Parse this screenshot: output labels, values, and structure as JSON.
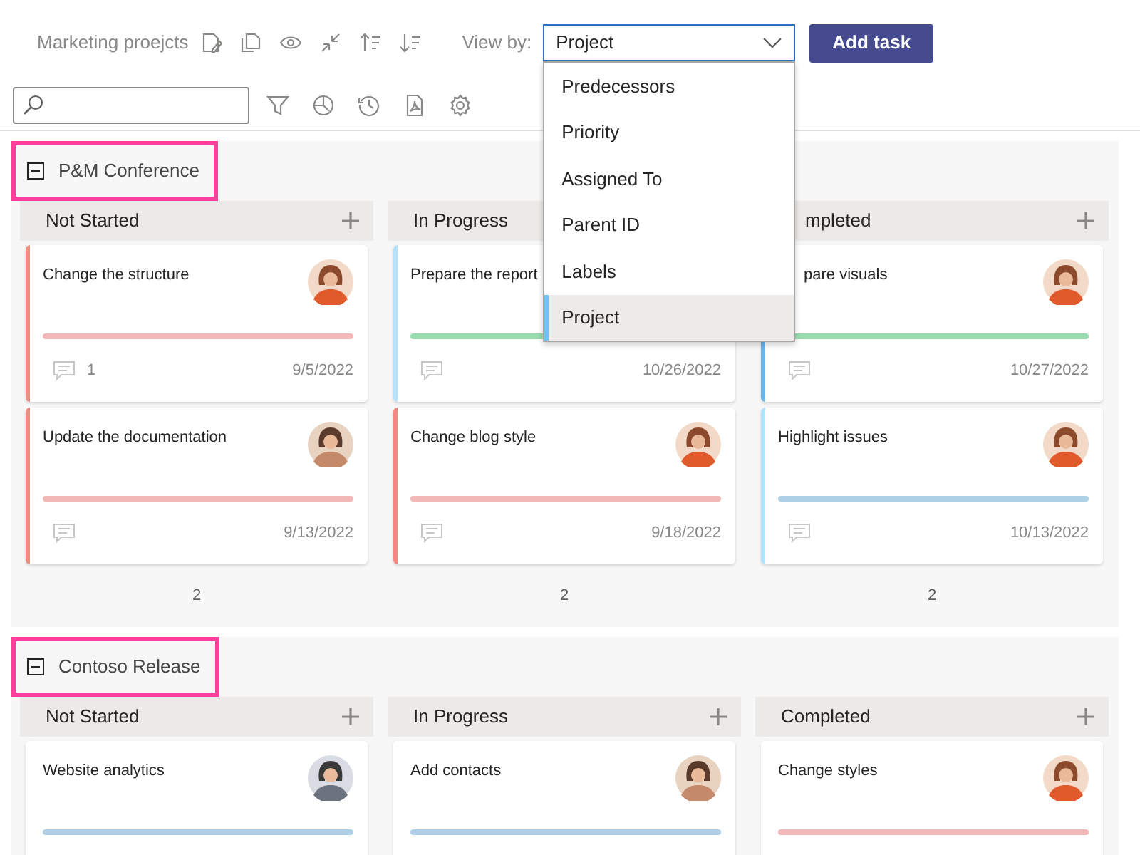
{
  "title": "Marketing proejcts",
  "view_by": {
    "label": "View by:",
    "value": "Project",
    "expanded": true,
    "options": [
      {
        "label": "Predecessors",
        "selected": false
      },
      {
        "label": "Priority",
        "selected": false
      },
      {
        "label": "Assigned To",
        "selected": false
      },
      {
        "label": "Parent ID",
        "selected": false
      },
      {
        "label": "Labels",
        "selected": false
      },
      {
        "label": "Project",
        "selected": true
      }
    ]
  },
  "add_button": "Add task",
  "groups": [
    {
      "name": "P&M Conference",
      "highlighted": true,
      "expanded": true,
      "columns": [
        {
          "label": "Not Started",
          "label_clipped": false,
          "count": "2",
          "cards": [
            {
              "title": "Change the structure",
              "title_clipped": false,
              "avatar": {
                "kind": "woman"
              },
              "color": "#f28b82",
              "bar": {
                "color": "#f2b8b8"
              },
              "comments": "1",
              "date": "9/5/2022"
            },
            {
              "title": "Update the documentation",
              "title_clipped": false,
              "avatar": {
                "kind": "glasses"
              },
              "color": "#f28b82",
              "bar": {
                "color": "#f2b8b8"
              },
              "date": "9/13/2022"
            }
          ]
        },
        {
          "label": "In Progress",
          "label_clipped": false,
          "count": "2",
          "cards": [
            {
              "title": "Prepare the report",
              "title_clipped": false,
              "color": "#b3e0fa",
              "bar": {
                "color": "#9adcb0"
              },
              "date": "10/26/2022"
            },
            {
              "title": "Change blog style",
              "title_clipped": false,
              "avatar": {
                "kind": "woman"
              },
              "color": "#f28b82",
              "bar": {
                "color": "#f2b8b8"
              },
              "date": "9/18/2022"
            }
          ]
        },
        {
          "label": "mpleted",
          "label_clipped": true,
          "count": "2",
          "cards": [
            {
              "title": "pare visuals",
              "title_clipped": true,
              "avatar": {
                "kind": "woman"
              },
              "color": "#6fb3e6",
              "bar": {
                "color": "#9adcb0"
              },
              "date": "10/27/2022"
            },
            {
              "title": "Highlight issues",
              "title_clipped": false,
              "avatar": {
                "kind": "woman"
              },
              "color": "#b3e0fa",
              "bar": {
                "color": "#aed0e6"
              },
              "date": "10/13/2022"
            }
          ]
        }
      ]
    },
    {
      "name": "Contoso Release",
      "highlighted": true,
      "expanded": true,
      "columns": [
        {
          "label": "Not Started",
          "label_clipped": false,
          "cards": [
            {
              "title": "Website analytics",
              "title_clipped": false,
              "avatar": {
                "kind": "man"
              },
              "color": "#ffffff",
              "bar": {
                "color": "#aed0e6"
              }
            }
          ]
        },
        {
          "label": "In Progress",
          "label_clipped": false,
          "cards": [
            {
              "title": "Add contacts",
              "title_clipped": false,
              "avatar": {
                "kind": "glasses"
              },
              "color": "#ffffff",
              "bar": {
                "color": "#aed0e6"
              }
            }
          ]
        },
        {
          "label": "Completed",
          "label_clipped": false,
          "cards": [
            {
              "title": "Change styles",
              "title_clipped": false,
              "avatar": {
                "kind": "woman"
              },
              "color": "#ffffff",
              "bar": {
                "color": "#f2b8b8"
              }
            }
          ]
        }
      ]
    }
  ]
}
